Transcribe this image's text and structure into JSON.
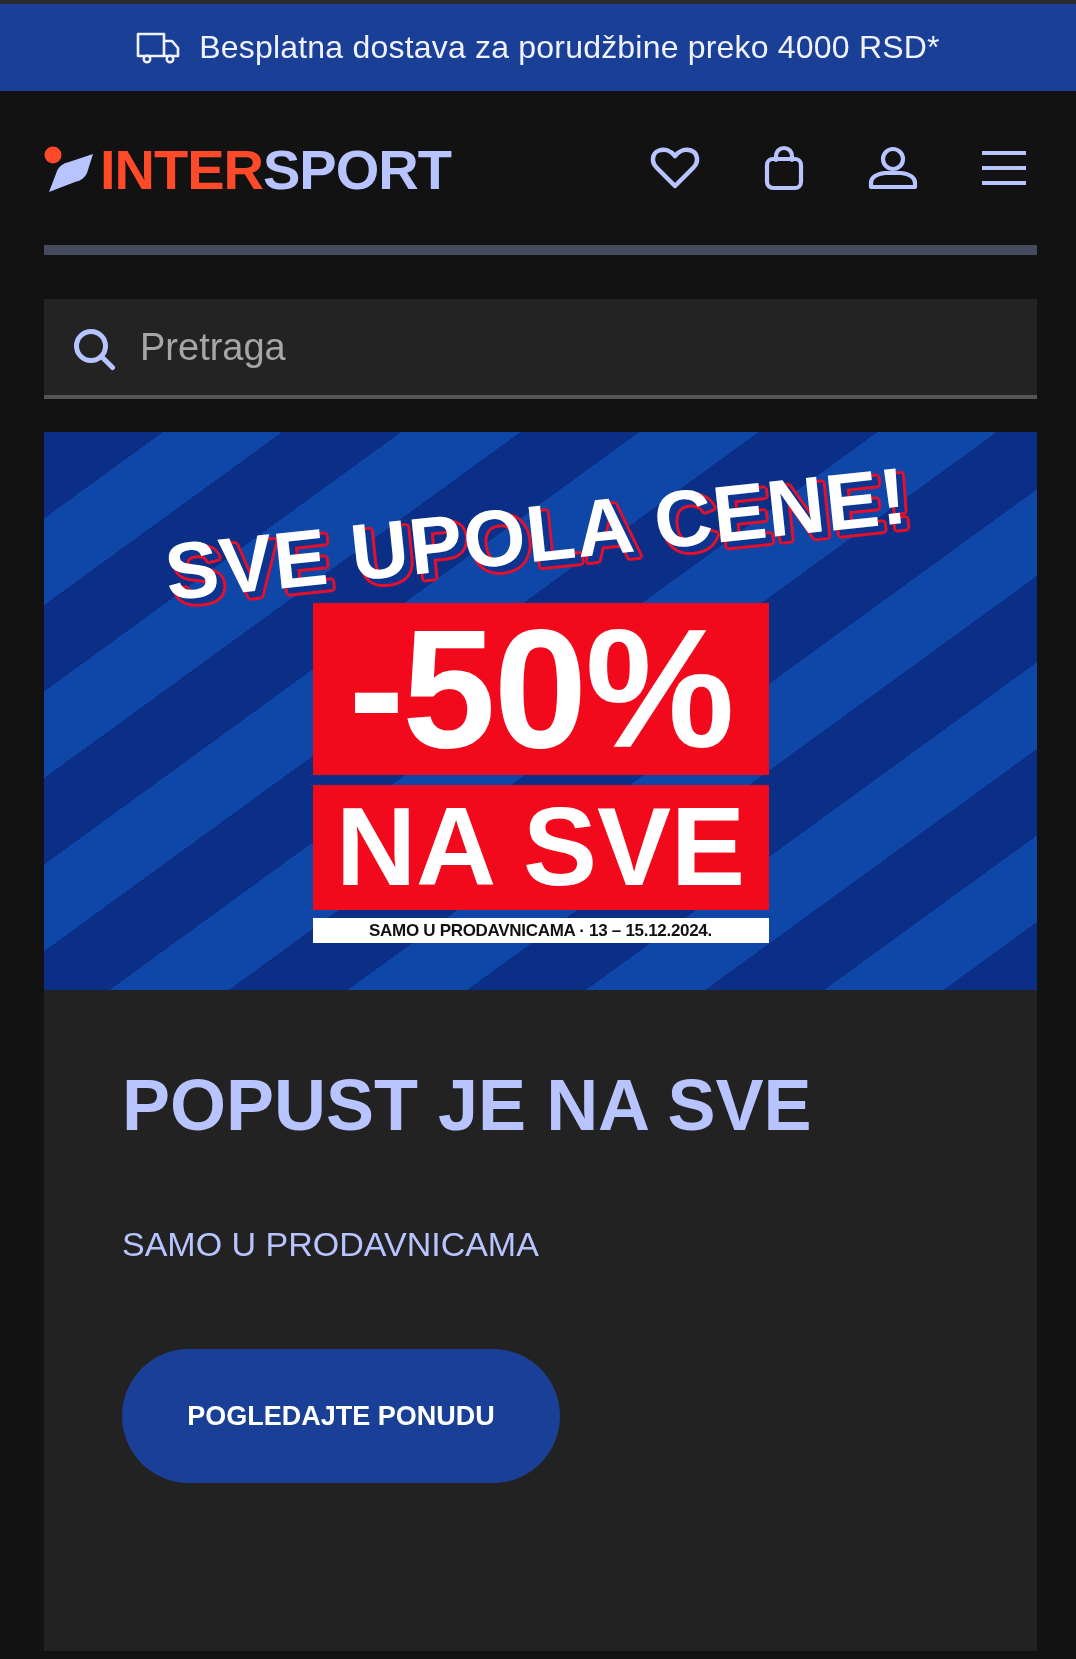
{
  "promo_bar": {
    "text": "Besplatna dostava za porudžbine preko 4000 RSD*"
  },
  "header": {
    "logo": {
      "part_1": "INTER",
      "part_2": "SPORT"
    }
  },
  "search": {
    "placeholder": "Pretraga"
  },
  "banner": {
    "headline": "SVE UPOLA CENE!",
    "discount": "-50%",
    "subline": "NA SVE",
    "note": "SAMO U PRODAVNICAMA · 13 – 15.12.2024."
  },
  "card": {
    "title": "POPUST JE NA SVE",
    "subtitle": "SAMO U PRODAVNICAMA",
    "button": "POGLEDAJTE PONUDU"
  }
}
